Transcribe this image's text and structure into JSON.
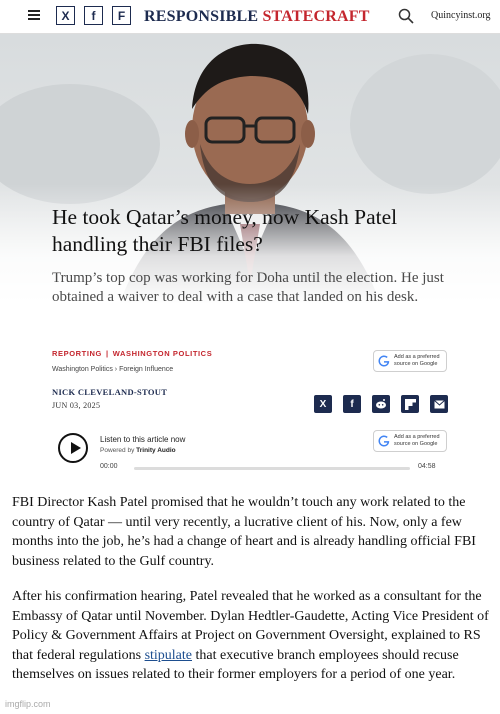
{
  "header": {
    "brand_part1": "RESPONSIBLE",
    "brand_part2": "STATECRAFT",
    "site": "Quincyinst.org",
    "social": [
      "X",
      "f",
      "F"
    ]
  },
  "article": {
    "headline": "He took Qatar’s money, now Kash Patel handling their FBI files?",
    "subhead": "Trump’s top cop was working for Doha until the election. He just obtained a waiver to deal with a case that landed on his desk.",
    "category1": "REPORTING",
    "category2": "WASHINGTON POLITICS",
    "crumb1": "Washington Politics",
    "crumb2": "Foreign Influence",
    "author": "NICK CLEVELAND-STOUT",
    "date": "JUN 03, 2025",
    "google_btn": "Add as a preferred source on Google",
    "share_icons": [
      "x-icon",
      "facebook-icon",
      "reddit-icon",
      "flipboard-icon",
      "email-icon"
    ]
  },
  "audio": {
    "listen": "Listen to this article now",
    "powered_prefix": "Powered by",
    "powered_by": "Trinity Audio",
    "time_start": "00:00",
    "time_end": "04:58",
    "progress": 0
  },
  "body": {
    "p1": "FBI Director Kash Patel promised that he wouldn’t touch any work related to the country of Qatar — until very recently, a lucrative client of his. Now, only a few months into the job, he’s had a change of heart and is already handling official FBI business related to the Gulf country.",
    "p2_a": "After his confirmation hearing, Patel revealed that he worked as a consultant for the Embassy of Qatar until November. Dylan Hedtler-Gaudette, Acting Vice President of Policy & Government Affairs at Project on Government Oversight, explained to RS that federal regulations ",
    "p2_link": "stipulate",
    "p2_b": " that executive branch employees should recuse themselves on issues related to their former employers for a period of one year."
  },
  "watermark": "imgflip.com",
  "colors": {
    "brand_navy": "#1d2b4f",
    "brand_red": "#c4262e",
    "link": "#1d4e8f"
  }
}
